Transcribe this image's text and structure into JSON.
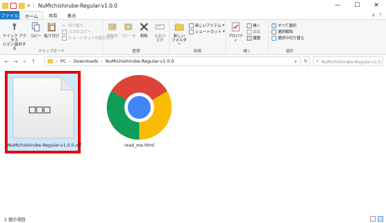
{
  "window": {
    "title": "NuMichishirube-Regular-v1.0.0",
    "controls": [
      "—",
      "☐",
      "✕"
    ]
  },
  "tabs": [
    {
      "label": "ファイル"
    },
    {
      "label": "ホーム"
    },
    {
      "label": "共有"
    },
    {
      "label": "表示"
    }
  ],
  "ribbon": {
    "clipboard": {
      "label": "クリップボード",
      "pin": "クイック アクセス\nにピン留めする",
      "copy": "コピー",
      "paste": "貼り付け",
      "cut": "切り取り",
      "copy_path": "パスのコピー",
      "paste_shortcut": "ショートカットの貼り付け"
    },
    "organize": {
      "label": "整理",
      "move_to": "移動先",
      "copy_to": "コピー先",
      "delete": "削除",
      "rename": "名前の\n変更"
    },
    "new": {
      "label": "新規",
      "new_folder": "新しい\nフォルダー",
      "new_item": "新しいアイテム",
      "easy_access": "ショートカット"
    },
    "open": {
      "label": "開く",
      "properties": "プロパティ",
      "open": "開く",
      "edit": "編集",
      "history": "履歴"
    },
    "select": {
      "label": "選択",
      "select_all": "すべて選択",
      "select_none": "選択解除",
      "invert": "選択の切り替え"
    }
  },
  "nav": {
    "back": "←",
    "forward": "→",
    "up": "↑",
    "path": [
      "PC",
      "Downloads",
      "NuMichishirube-Regular-v1.0.0"
    ],
    "search_placeholder": "NuMichishirube-Regular-v1.0.0の検索"
  },
  "files": [
    {
      "name": "NuMichishirube-Regular-v1.0.0.otf",
      "glyph": "□□□",
      "selected": true
    },
    {
      "name": "read_me.html",
      "icon": "chrome-icon",
      "selected": false
    }
  ],
  "status": {
    "count": "2 個の項目"
  },
  "colors": {
    "file_tab": "#1979ca",
    "selection_fill": "#cce8ff",
    "highlight_border": "#e50000"
  }
}
